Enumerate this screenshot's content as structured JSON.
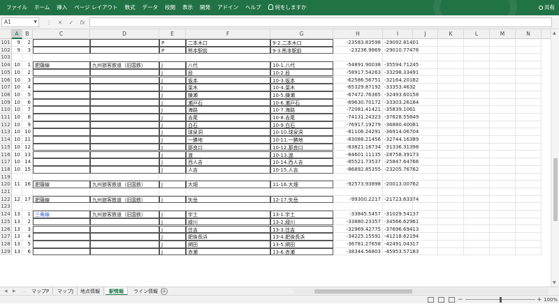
{
  "ribbon": {
    "tabs": [
      "ファイル",
      "ホーム",
      "挿入",
      "ページ レイアウト",
      "数式",
      "データ",
      "校閲",
      "表示",
      "開発",
      "アドイン",
      "ヘルプ"
    ],
    "tell_me": "何をしますか",
    "share": "共有"
  },
  "formula_bar": {
    "name_box": "A1",
    "cancel": "✕",
    "enter": "✓",
    "fx": "fx",
    "formula": ""
  },
  "columns": [
    "A",
    "B",
    "C",
    "D",
    "E",
    "F",
    "G",
    "H",
    "I",
    "J",
    "K",
    "L",
    "M",
    "N"
  ],
  "rows": [
    {
      "n": "101",
      "A": "9",
      "B": "2",
      "C": "",
      "D": "",
      "E": "P",
      "F": "二本木口",
      "G": "9-2.二本木口",
      "H": "-23583.83598",
      "I": "-29092.81401"
    },
    {
      "n": "102",
      "A": "9",
      "B": "3",
      "C": "",
      "D": "",
      "E": "P",
      "F": "熊本駅前",
      "G": "9-3.熊本駅前",
      "H": "-23236.9869",
      "I": "-29010.77476"
    },
    {
      "n": "103",
      "A": "",
      "B": "",
      "C": "",
      "D": "",
      "E": "",
      "F": "",
      "G": "",
      "H": "",
      "I": ""
    },
    {
      "n": "104",
      "A": "10",
      "B": "1",
      "C": "肥薩線",
      "D": "九州旅客鉄道（旧国鉄）",
      "E": "J",
      "F": "八代",
      "G": "10-1.八代",
      "H": "-54891.90038",
      "I": "-35594.71245"
    },
    {
      "n": "105",
      "A": "10",
      "B": "2",
      "C": "",
      "D": "",
      "E": "J",
      "F": "段",
      "G": "10-2.段",
      "H": "-58917.54263",
      "I": "-33298.33491"
    },
    {
      "n": "106",
      "A": "10",
      "B": "3",
      "C": "",
      "D": "",
      "E": "J",
      "F": "坂本",
      "G": "10-3.坂本",
      "H": "-62586.56751",
      "I": "-32164.20182"
    },
    {
      "n": "107",
      "A": "10",
      "B": "4",
      "C": "",
      "D": "",
      "E": "J",
      "F": "葉木",
      "G": "10-4.葉木",
      "H": "-65329.87192",
      "I": "-33353.4632"
    },
    {
      "n": "108",
      "A": "10",
      "B": "5",
      "C": "",
      "D": "",
      "E": "J",
      "F": "鎌瀬",
      "G": "10-5.鎌瀬",
      "H": "-67472.76365",
      "I": "-32493.60158"
    },
    {
      "n": "109",
      "A": "10",
      "B": "6",
      "C": "",
      "D": "",
      "E": "J",
      "F": "瀬戸石",
      "G": "10-6.瀬戸石",
      "H": "-69630.70172",
      "I": "-33303.26184"
    },
    {
      "n": "110",
      "A": "10",
      "B": "7",
      "C": "",
      "D": "",
      "E": "J",
      "F": "海路",
      "G": "10-7.海路",
      "H": "-72081.41421",
      "I": "-35839.1061"
    },
    {
      "n": "111",
      "A": "10",
      "B": "8",
      "C": "",
      "D": "",
      "E": "J",
      "F": "吉尾",
      "G": "10-8.吉尾",
      "H": "-74131.24323",
      "I": "-37628.55849"
    },
    {
      "n": "112",
      "A": "10",
      "B": "9",
      "C": "",
      "D": "",
      "E": "J",
      "F": "白石",
      "G": "10-9.白石",
      "H": "-76917.19279",
      "I": "-36880.40081"
    },
    {
      "n": "113",
      "A": "10",
      "B": "10",
      "C": "",
      "D": "",
      "E": "J",
      "F": "球泉洞",
      "G": "10-10.球泉洞",
      "H": "-81106.24291",
      "I": "-36914.06704"
    },
    {
      "n": "114",
      "A": "10",
      "B": "11",
      "C": "",
      "D": "",
      "E": "J",
      "F": "一勝地",
      "G": "10-11.一勝地",
      "H": "-83088.21456",
      "I": "-32744.16389"
    },
    {
      "n": "115",
      "A": "10",
      "B": "12",
      "C": "",
      "D": "",
      "E": "J",
      "F": "那良口",
      "G": "10-12.那良口",
      "H": "-83821.16734",
      "I": "-31336.31398"
    },
    {
      "n": "116",
      "A": "10",
      "B": "13",
      "C": "",
      "D": "",
      "E": "J",
      "F": "渡",
      "G": "10-13.渡",
      "H": "-84601.11135",
      "I": "-28758.39173"
    },
    {
      "n": "117",
      "A": "10",
      "B": "14",
      "C": "",
      "D": "",
      "E": "J",
      "F": "西人吉",
      "G": "10-14.西人吉",
      "H": "-85521.73537",
      "I": "-25847.64766"
    },
    {
      "n": "118",
      "A": "10",
      "B": "15",
      "C": "",
      "D": "",
      "E": "J",
      "F": "人吉",
      "G": "10-15.人吉",
      "H": "-86892.85355",
      "I": "-23205.76762"
    },
    {
      "n": "119",
      "A": "",
      "B": "",
      "C": "",
      "D": "",
      "E": "",
      "F": "",
      "G": "",
      "H": "",
      "I": ""
    },
    {
      "n": "120",
      "A": "11",
      "B": "16",
      "C": "肥薩線",
      "D": "九州旅客鉄道（旧国鉄）",
      "E": "J",
      "F": "大畑",
      "G": "11-16.大畑",
      "H": "-92573.93898",
      "I": "-20013.00762"
    },
    {
      "n": "121",
      "A": "",
      "B": "",
      "C": "",
      "D": "",
      "E": "",
      "F": "",
      "G": "",
      "H": "",
      "I": ""
    },
    {
      "n": "122",
      "A": "12",
      "B": "17",
      "C": "肥薩線",
      "D": "九州旅客鉄道（旧国鉄）",
      "E": "J",
      "F": "矢岳",
      "G": "12-17.矢岳",
      "H": "-99300.2217",
      "I": "-21723.63374"
    },
    {
      "n": "123",
      "A": "",
      "B": "",
      "C": "",
      "D": "",
      "E": "",
      "F": "",
      "G": "",
      "H": "",
      "I": ""
    },
    {
      "n": "124",
      "A": "13",
      "B": "1",
      "C": "三角線",
      "D": "九州旅客鉄道（旧国鉄）",
      "E": "J",
      "F": "宇土",
      "G": "13-1.宇土",
      "H": "-33845.5457",
      "I": "-31029.54137"
    },
    {
      "n": "125",
      "A": "13",
      "B": "2",
      "C": "",
      "D": "",
      "E": "J",
      "F": "緑川",
      "G": "13-2.緑川",
      "H": "-33880.23357",
      "I": "-34566.62961"
    },
    {
      "n": "126",
      "A": "13",
      "B": "3",
      "C": "",
      "D": "",
      "E": "J",
      "F": "住吉",
      "G": "13-3.住吉",
      "H": "-32969.42775",
      "I": "-37696.69413"
    },
    {
      "n": "127",
      "A": "13",
      "B": "4",
      "C": "",
      "D": "",
      "E": "J",
      "F": "肥後長浜",
      "G": "13-4.肥後長浜",
      "H": "-34225.15591",
      "I": "-41218.62194"
    },
    {
      "n": "128",
      "A": "13",
      "B": "5",
      "C": "",
      "D": "",
      "E": "J",
      "F": "網田",
      "G": "13-5.網田",
      "H": "-36781.27658",
      "I": "-42491.04317"
    },
    {
      "n": "129",
      "A": "13",
      "B": "6",
      "C": "",
      "D": "",
      "E": "J",
      "F": "赤瀬",
      "G": "13-6.赤瀬",
      "H": "-38344.56803",
      "I": "-45953.57183"
    }
  ],
  "sheet_tabs": [
    "マップP",
    "マップJ",
    "地点情報",
    "駅情報",
    "ライン情報"
  ],
  "active_sheet": "駅情報",
  "add_sheet": "+",
  "nav": {
    "prev": "◀",
    "next": "▶",
    "more": "..."
  },
  "status": {
    "zoom": "100%",
    "zoom_percent": 100,
    "minus": "−",
    "plus": "+"
  },
  "colors": {
    "ribbon": "#217346",
    "link_text": "#2b5ad8"
  }
}
